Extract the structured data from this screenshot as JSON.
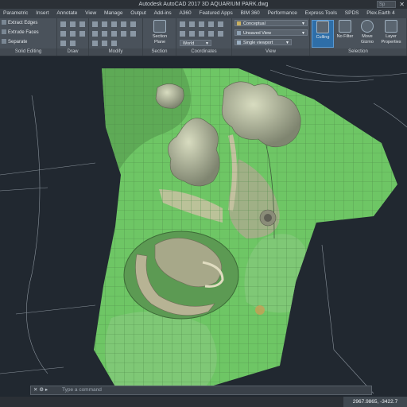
{
  "app": {
    "title": "Autodesk AutoCAD 2017    3D AQUARIUM PARK.dwg",
    "search_placeholder": "Sp"
  },
  "menu": {
    "tabs": [
      "Parametric",
      "Insert",
      "Annotate",
      "View",
      "Manage",
      "Output",
      "Add-ins",
      "A360",
      "Featured Apps",
      "BIM 360",
      "Performance",
      "Express Tools",
      "SPDS",
      "Plex.Earth 4"
    ]
  },
  "ribbon": {
    "solid_editing": {
      "buttons": [
        "Extract Edges",
        "Extrude Faces",
        "Separate"
      ],
      "label": "Solid Editing"
    },
    "draw": {
      "label": "Draw"
    },
    "modify": {
      "label": "Modify"
    },
    "section": {
      "button": "Section Plane",
      "label": "Section"
    },
    "coordinates": {
      "world": "World",
      "label": "Coordinates"
    },
    "view": {
      "visual_style": "Conceptual",
      "saved_view": "Unsaved View",
      "viewport": "Single viewport",
      "label": "View"
    },
    "selection": {
      "culling": "Culling",
      "no_filter": "No Filter",
      "move_gizmo": "Move Gizmo",
      "layer_properties": "Layer Properties",
      "label": "Selection"
    }
  },
  "command": {
    "placeholder": "Type a command"
  },
  "status": {
    "coordinates": "2967.9865, -3422.7"
  },
  "colors": {
    "background": "#212830",
    "grass": "#6ec665",
    "grid": "#5a8a55",
    "building": "#b4b79a"
  }
}
